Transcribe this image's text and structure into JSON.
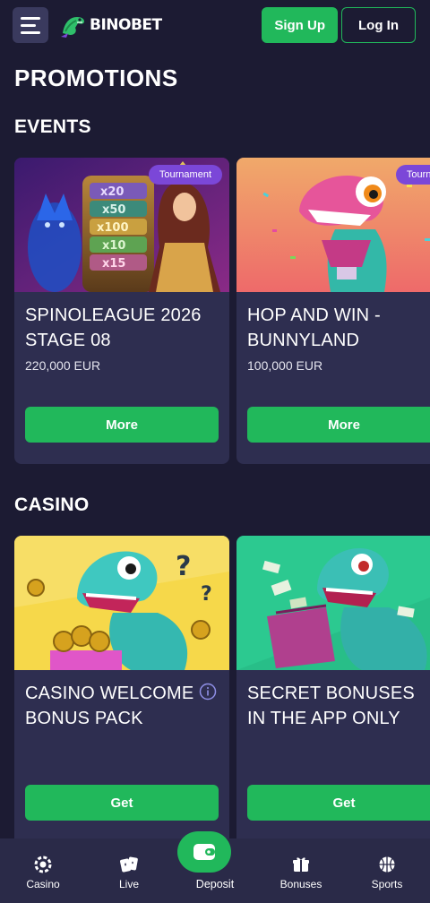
{
  "header": {
    "brand": "BINOBET",
    "signup_label": "Sign Up",
    "login_label": "Log In"
  },
  "page": {
    "title": "PROMOTIONS"
  },
  "events": {
    "title": "EVENTS",
    "cards": [
      {
        "badge": "Tournament",
        "title": "SPINOLEAGUE 2026 STAGE 08",
        "prize": "220,000 EUR",
        "button": "More"
      },
      {
        "badge": "Tournament",
        "title": "HOP AND WIN - BUNNYLAND",
        "prize": "100,000 EUR",
        "button": "More"
      }
    ]
  },
  "casino": {
    "title": "CASINO",
    "cards": [
      {
        "title": "CASINO WELCOME BONUS PACK",
        "button": "Get"
      },
      {
        "title": "SECRET BONUSES IN THE APP ONLY",
        "button": "Get"
      }
    ]
  },
  "bottom_nav": {
    "items": [
      {
        "label": "Casino",
        "icon": "casino-chip-icon"
      },
      {
        "label": "Live",
        "icon": "cards-icon"
      },
      {
        "label": "Deposit",
        "icon": "wallet-icon"
      },
      {
        "label": "Bonuses",
        "icon": "gift-icon"
      },
      {
        "label": "Sports",
        "icon": "basketball-icon"
      }
    ]
  },
  "colors": {
    "background": "#1c1b33",
    "card": "#2e2e50",
    "accent_green": "#21b85b",
    "badge_purple": "#7b47d8"
  }
}
